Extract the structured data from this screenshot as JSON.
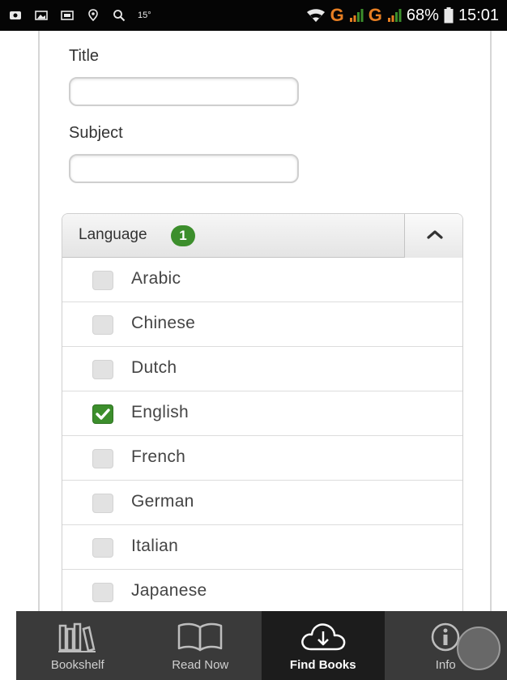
{
  "status_bar": {
    "temperature": "15°",
    "battery": "68%",
    "time": "15:01",
    "network": [
      "G",
      "G"
    ]
  },
  "form": {
    "title_label": "Title",
    "title_value": "",
    "subject_label": "Subject",
    "subject_value": ""
  },
  "language_filter": {
    "title": "Language",
    "badge": "1",
    "expanded": true,
    "options": [
      {
        "label": "Arabic",
        "checked": false
      },
      {
        "label": "Chinese",
        "checked": false
      },
      {
        "label": "Dutch",
        "checked": false
      },
      {
        "label": "English",
        "checked": true
      },
      {
        "label": "French",
        "checked": false
      },
      {
        "label": "German",
        "checked": false
      },
      {
        "label": "Italian",
        "checked": false
      },
      {
        "label": "Japanese",
        "checked": false
      }
    ]
  },
  "tabs": [
    {
      "label": "Bookshelf",
      "icon": "bookshelf-icon",
      "active": false
    },
    {
      "label": "Read Now",
      "icon": "open-book-icon",
      "active": false
    },
    {
      "label": "Find Books",
      "icon": "cloud-download-icon",
      "active": true
    },
    {
      "label": "Info",
      "icon": "info-icon",
      "active": false
    }
  ],
  "colors": {
    "accent_green": "#3c8e2c",
    "status_bar": "#050505",
    "tab_bar": "#3a3a3a",
    "tab_active": "#1c1c1c"
  }
}
